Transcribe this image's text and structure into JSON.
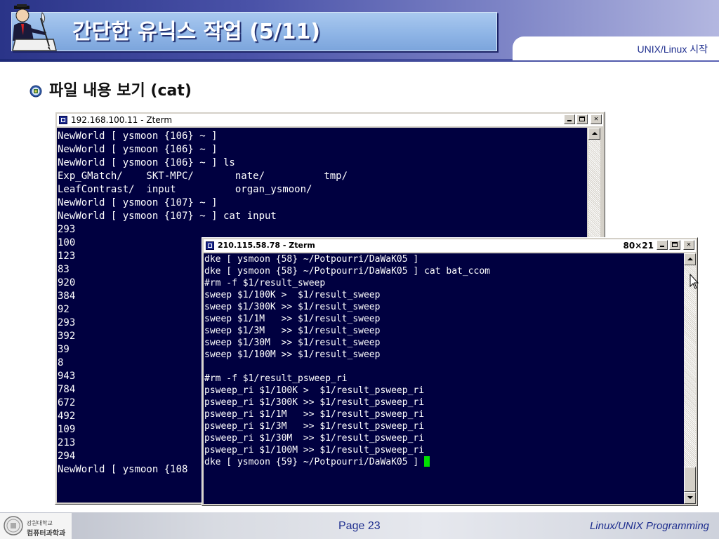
{
  "slide": {
    "title": "간단한 유닉스 작업 (5/11)",
    "tab_label": "UNIX/Linux 시작",
    "bullet": "파일 내용 보기 (cat)",
    "page_label": "Page 23",
    "course_label": "Linux/UNIX Programming",
    "org_line1": "강원대학교",
    "org_line2": "컴퓨터과학과"
  },
  "window1": {
    "title": "192.168.100.11 - Zterm",
    "lines": [
      "NewWorld [ ysmoon {106} ~ ]",
      "NewWorld [ ysmoon {106} ~ ]",
      "NewWorld [ ysmoon {106} ~ ] ls",
      "Exp_GMatch/    SKT-MPC/       nate/          tmp/",
      "LeafContrast/  input          organ_ysmoon/",
      "NewWorld [ ysmoon {107} ~ ]",
      "NewWorld [ ysmoon {107} ~ ] cat input",
      "293",
      "100",
      "123",
      "83",
      "920",
      "384",
      "92",
      "293",
      "392",
      "39",
      "8",
      "943",
      "784",
      "672",
      "492",
      "109",
      "213",
      "294",
      "NewWorld [ ysmoon {108"
    ]
  },
  "window2": {
    "title": "210.115.58.78 - Zterm",
    "size": "80×21",
    "lines": [
      "dke [ ysmoon {58} ~/Potpourri/DaWaK05 ]",
      "dke [ ysmoon {58} ~/Potpourri/DaWaK05 ] cat bat_ccom",
      "#rm -f $1/result_sweep",
      "sweep $1/100K >  $1/result_sweep",
      "sweep $1/300K >> $1/result_sweep",
      "sweep $1/1M   >> $1/result_sweep",
      "sweep $1/3M   >> $1/result_sweep",
      "sweep $1/30M  >> $1/result_sweep",
      "sweep $1/100M >> $1/result_sweep",
      "",
      "#rm -f $1/result_psweep_ri",
      "psweep_ri $1/100K >  $1/result_psweep_ri",
      "psweep_ri $1/300K >> $1/result_psweep_ri",
      "psweep_ri $1/1M   >> $1/result_psweep_ri",
      "psweep_ri $1/3M   >> $1/result_psweep_ri",
      "psweep_ri $1/30M  >> $1/result_psweep_ri",
      "psweep_ri $1/100M >> $1/result_psweep_ri",
      "dke [ ysmoon {59} ~/Potpourri/DaWaK05 ] "
    ]
  },
  "colors": {
    "terminal_bg": "#000040",
    "terminal_text": "#ffffff",
    "cursor": "#00e000",
    "accent": "#1f2f8f"
  },
  "icons": {
    "title": "man-at-desk-icon",
    "bullet": "bullet-seal-icon",
    "footer": "university-seal-icon",
    "pointer": "mouse-pointer-icon"
  }
}
